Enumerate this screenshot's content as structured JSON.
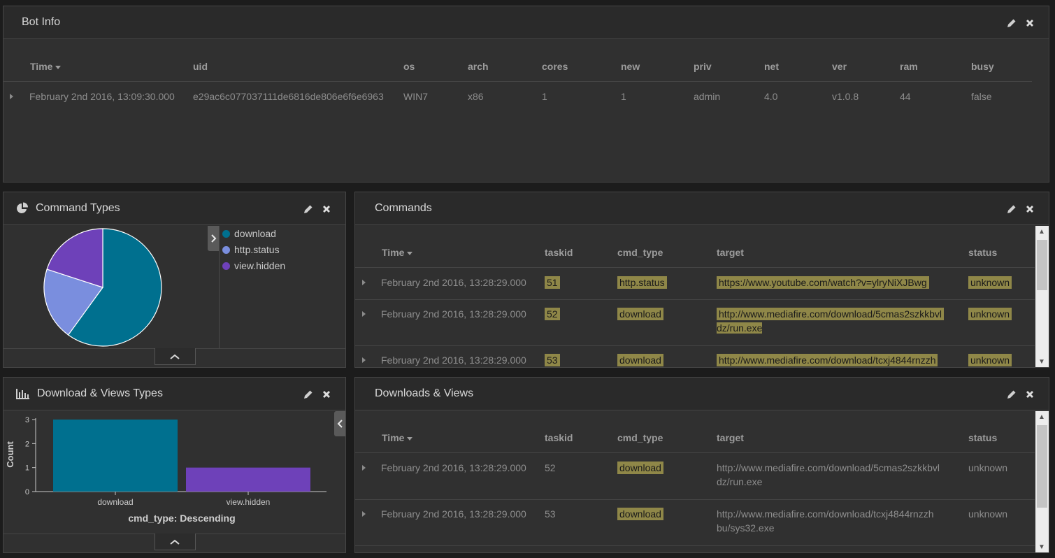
{
  "panels": {
    "bot_info": {
      "title": "Bot Info",
      "headers": [
        "Time",
        "uid",
        "os",
        "arch",
        "cores",
        "new",
        "priv",
        "net",
        "ver",
        "ram",
        "busy"
      ],
      "row": [
        "February 2nd 2016, 13:09:30.000",
        "e29ac6c077037111de6816de806e6f6e6963",
        "WIN7",
        "x86",
        "1",
        "1",
        "admin",
        "4.0",
        "v1.0.8",
        "44",
        "false"
      ]
    },
    "command_types": {
      "title": "Command Types",
      "legend": [
        {
          "label": "download",
          "color": "#00708f"
        },
        {
          "label": "http.status",
          "color": "#7a8ede"
        },
        {
          "label": "view.hidden",
          "color": "#6e41b9"
        }
      ]
    },
    "commands": {
      "title": "Commands",
      "headers": [
        "Time",
        "taskid",
        "cmd_type",
        "target",
        "status"
      ],
      "rows": [
        {
          "time": "February 2nd 2016, 13:28:29.000",
          "taskid": "51",
          "cmd_type": "http.status",
          "target1": "https://www.youtube.com/watch?v=ylryNiXJBwg",
          "target2": "",
          "status": "unknown"
        },
        {
          "time": "February 2nd 2016, 13:28:29.000",
          "taskid": "52",
          "cmd_type": "download",
          "target1": "http://www.mediafire.com/download/5cmas2szkkbvl",
          "target2": "dz/run.exe",
          "status": "unknown"
        },
        {
          "time": "February 2nd 2016, 13:28:29.000",
          "taskid": "53",
          "cmd_type": "download",
          "target1": "http://www.mediafire.com/download/tcxj4844rnzzh",
          "target2": "",
          "status": "unknown"
        }
      ]
    },
    "dv_types": {
      "title": "Download & Views Types"
    },
    "downloads_views": {
      "title": "Downloads & Views",
      "headers": [
        "Time",
        "taskid",
        "cmd_type",
        "target",
        "status"
      ],
      "rows": [
        {
          "time": "February 2nd 2016, 13:28:29.000",
          "taskid": "52",
          "cmd_type": "download",
          "target1": "http://www.mediafire.com/download/5cmas2szkkbvl",
          "target2": "dz/run.exe",
          "status": "unknown"
        },
        {
          "time": "February 2nd 2016, 13:28:29.000",
          "taskid": "53",
          "cmd_type": "download",
          "target1": "http://www.mediafire.com/download/tcxj4844rnzzh",
          "target2": "bu/sys32.exe",
          "status": "unknown"
        }
      ]
    }
  },
  "chart_data": [
    {
      "type": "pie",
      "title": "",
      "categories": [
        "download",
        "http.status",
        "view.hidden"
      ],
      "values": [
        3,
        1,
        1
      ],
      "colors": [
        "#00708f",
        "#7a8ede",
        "#6e41b9"
      ]
    },
    {
      "type": "bar",
      "title": "",
      "categories": [
        "download",
        "view.hidden"
      ],
      "values": [
        3,
        1
      ],
      "colors": [
        "#00708f",
        "#6e41b9"
      ],
      "xlabel": "cmd_type: Descending",
      "ylabel": "Count",
      "ylim": [
        0,
        3
      ],
      "yticks": [
        "0",
        "1",
        "2",
        "3"
      ]
    }
  ]
}
